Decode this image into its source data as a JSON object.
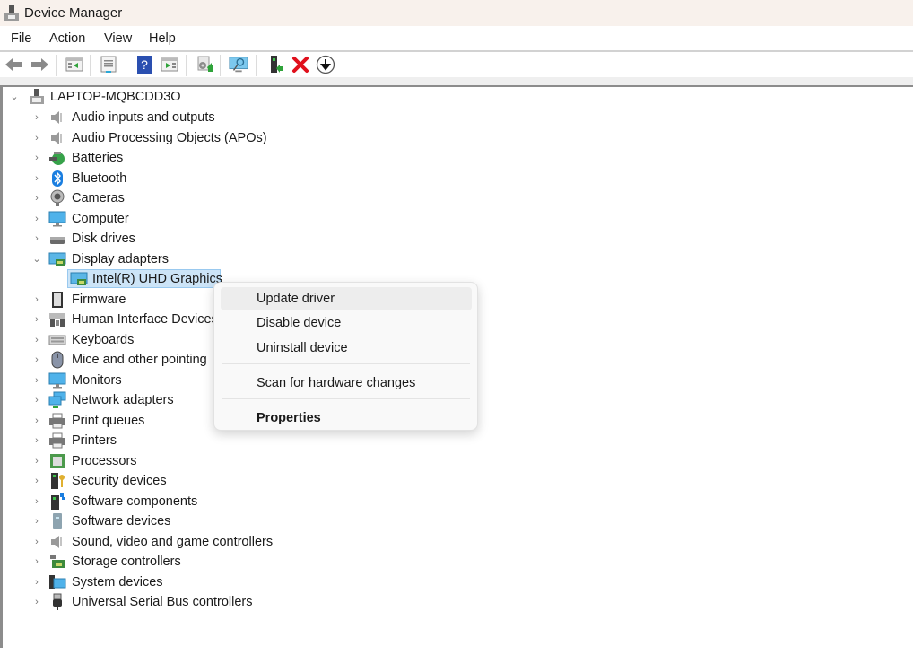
{
  "window": {
    "title": "Device Manager",
    "app_icon": "device-manager-icon"
  },
  "menubar": {
    "items": [
      "File",
      "Action",
      "View",
      "Help"
    ]
  },
  "toolbar": {
    "buttons": [
      {
        "name": "back",
        "icon": "arrow-left-icon"
      },
      {
        "name": "forward",
        "icon": "arrow-right-icon"
      },
      {
        "name": "show-hide-console-tree",
        "icon": "console-tree-icon"
      },
      {
        "name": "properties",
        "icon": "properties-sheet-icon"
      },
      {
        "name": "help",
        "icon": "help-icon",
        "glyph": "?"
      },
      {
        "name": "show-hide-action-pane",
        "icon": "action-pane-icon"
      },
      {
        "name": "update-driver",
        "icon": "update-driver-icon"
      },
      {
        "name": "scan-hardware-changes",
        "icon": "scan-monitor-icon"
      },
      {
        "name": "enable-device",
        "icon": "enable-device-icon"
      },
      {
        "name": "uninstall-device",
        "icon": "uninstall-x-icon",
        "glyph": "✖"
      },
      {
        "name": "disable-device",
        "icon": "download-circle-icon",
        "glyph": "⬇"
      }
    ]
  },
  "tree": {
    "root": {
      "label": "LAPTOP-MQBCDD3O",
      "expanded": true,
      "icon": "computer-tower-icon"
    },
    "categories": [
      {
        "label": "Audio inputs and outputs",
        "icon": "speaker-icon",
        "expanded": false
      },
      {
        "label": "Audio Processing Objects (APOs)",
        "icon": "speaker-icon",
        "expanded": false
      },
      {
        "label": "Batteries",
        "icon": "battery-icon",
        "expanded": false
      },
      {
        "label": "Bluetooth",
        "icon": "bluetooth-icon",
        "expanded": false
      },
      {
        "label": "Cameras",
        "icon": "camera-icon",
        "expanded": false
      },
      {
        "label": "Computer",
        "icon": "monitor-icon",
        "expanded": false
      },
      {
        "label": "Disk drives",
        "icon": "disk-drive-icon",
        "expanded": false
      },
      {
        "label": "Display adapters",
        "icon": "display-adapter-icon",
        "expanded": true,
        "children": [
          {
            "label": "Intel(R) UHD Graphics",
            "icon": "display-adapter-icon",
            "selected": true
          }
        ]
      },
      {
        "label": "Firmware",
        "icon": "firmware-chip-icon",
        "expanded": false
      },
      {
        "label": "Human Interface Devices",
        "icon": "hid-icon",
        "expanded": false
      },
      {
        "label": "Keyboards",
        "icon": "keyboard-icon",
        "expanded": false
      },
      {
        "label": "Mice and other pointing devices",
        "visible_label": "Mice and other pointing",
        "icon": "mouse-icon",
        "expanded": false
      },
      {
        "label": "Monitors",
        "icon": "monitor-icon",
        "expanded": false
      },
      {
        "label": "Network adapters",
        "icon": "network-icon",
        "expanded": false
      },
      {
        "label": "Print queues",
        "icon": "printer-icon",
        "expanded": false
      },
      {
        "label": "Printers",
        "icon": "printer-icon",
        "expanded": false
      },
      {
        "label": "Processors",
        "icon": "processor-icon",
        "expanded": false
      },
      {
        "label": "Security devices",
        "icon": "security-key-icon",
        "expanded": false
      },
      {
        "label": "Software components",
        "icon": "software-component-icon",
        "expanded": false
      },
      {
        "label": "Software devices",
        "icon": "software-device-icon",
        "expanded": false
      },
      {
        "label": "Sound, video and game controllers",
        "icon": "speaker-icon",
        "expanded": false
      },
      {
        "label": "Storage controllers",
        "icon": "storage-controller-icon",
        "expanded": false
      },
      {
        "label": "System devices",
        "icon": "system-devices-icon",
        "expanded": false
      },
      {
        "label": "Universal Serial Bus controllers",
        "icon": "usb-plug-icon",
        "expanded": false
      }
    ]
  },
  "context_menu": {
    "items": [
      {
        "label": "Update driver",
        "highlighted": true
      },
      {
        "label": "Disable device"
      },
      {
        "label": "Uninstall device"
      },
      {
        "separator": true
      },
      {
        "label": "Scan for hardware changes"
      },
      {
        "separator": true
      },
      {
        "label": "Properties",
        "bold": true
      }
    ]
  },
  "colors": {
    "selection_bg": "#cce4f7",
    "selection_border": "#99c9ef",
    "titlebar_bg": "#f8f1ec",
    "uninstall_red": "#e0101c",
    "help_blue": "#2a4fb0"
  }
}
